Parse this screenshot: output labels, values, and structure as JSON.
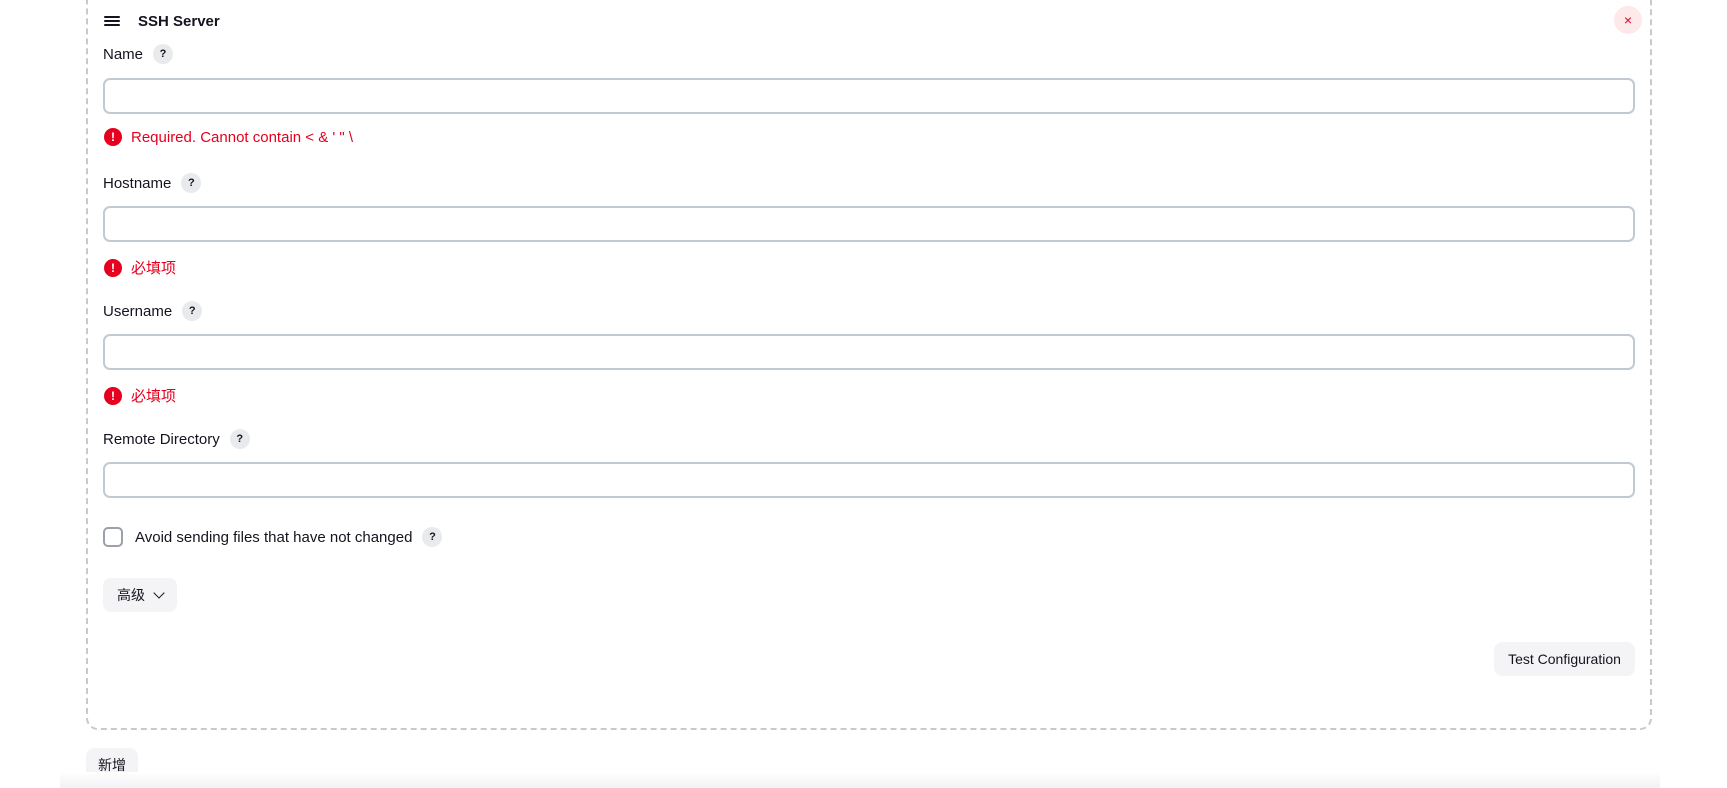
{
  "header": {
    "title": "SSH Server",
    "close_glyph": "×"
  },
  "fields": [
    {
      "label": "Name",
      "value": "",
      "error": "Required. Cannot contain < & ' \" \\"
    },
    {
      "label": "Hostname",
      "value": "",
      "error": "必填项"
    },
    {
      "label": "Username",
      "value": "",
      "error": "必填项"
    },
    {
      "label": "Remote Directory",
      "value": ""
    }
  ],
  "help_glyph": "?",
  "error_glyph": "!",
  "checkbox": {
    "label": "Avoid sending files that have not changed",
    "checked": false
  },
  "advanced_button": "高级",
  "test_button": "Test Configuration",
  "add_button": "新增",
  "colors": {
    "error": "#e6001f",
    "border": "#c2c9d3",
    "button_bg": "#f4f4f6"
  },
  "icons": [
    "drag-handle-icon",
    "close-icon",
    "help-icon",
    "error-icon",
    "chevron-down-icon"
  ]
}
